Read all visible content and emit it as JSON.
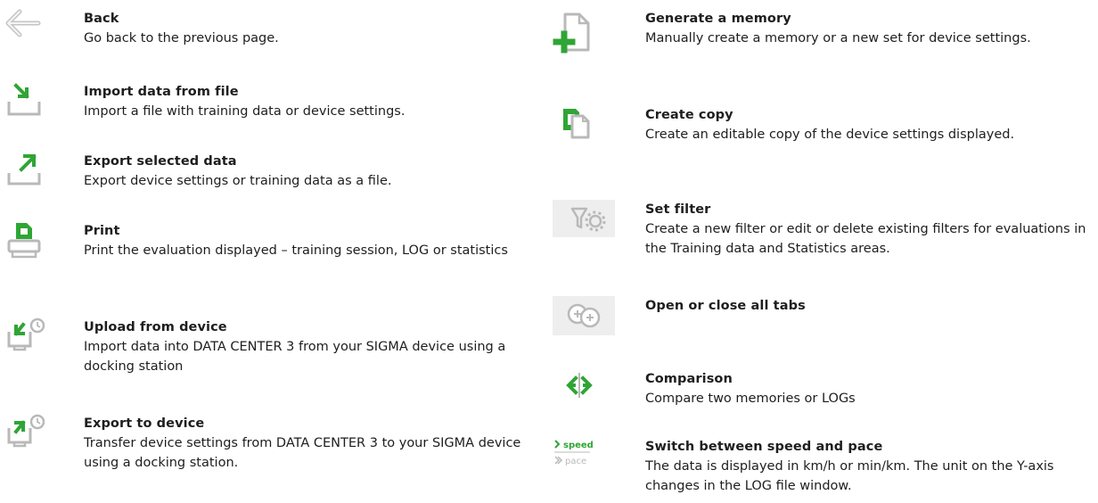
{
  "left": [
    {
      "icon": "back-arrow-icon",
      "title": "Back",
      "desc": "Go back to the previous page."
    },
    {
      "icon": "import-icon",
      "title": "Import data from file",
      "desc": "Import a file with training data or device settings."
    },
    {
      "icon": "export-icon",
      "title": "Export selected data",
      "desc": "Export device settings or training data as a file."
    },
    {
      "icon": "printer-icon",
      "title": "Print",
      "desc": "Print the evaluation displayed – training session, LOG or statistics"
    },
    {
      "icon": "upload-from-device-icon",
      "title": "Upload from device",
      "desc": "Import data into DATA CENTER 3 from your SIGMA device using a docking station"
    },
    {
      "icon": "export-to-device-icon",
      "title": "Export to device",
      "desc": "Transfer device settings from DATA CENTER 3 to your SIGMA device using a docking station."
    }
  ],
  "right": [
    {
      "icon": "new-document-icon",
      "title": "Generate a memory",
      "desc": "Manually create a memory or a new set for device settings."
    },
    {
      "icon": "copy-document-icon",
      "title": "Create copy",
      "desc": "Create an editable copy of the device settings displayed."
    },
    {
      "icon": "filter-settings-icon",
      "title": "Set filter",
      "desc": "Create a new filter or edit or delete existing filters for evaluations in the Training data and Statistics areas."
    },
    {
      "icon": "open-close-tabs-icon",
      "title": "Open or close all tabs",
      "desc": ""
    },
    {
      "icon": "comparison-icon",
      "title": "Comparison",
      "desc": "Compare two memories or LOGs"
    },
    {
      "icon": "speed-pace-icon",
      "title": "Switch between speed and pace",
      "desc": "The data is displayed in km/h or min/km. The unit on the Y-axis changes in the LOG file window.",
      "icon_text": {
        "speed": "speed",
        "pace": "pace"
      }
    },
    {
      "colors": {
        "green": "#2fa535",
        "gray": "#b9b9b9",
        "dark": "#1e1e1e"
      }
    }
  ]
}
